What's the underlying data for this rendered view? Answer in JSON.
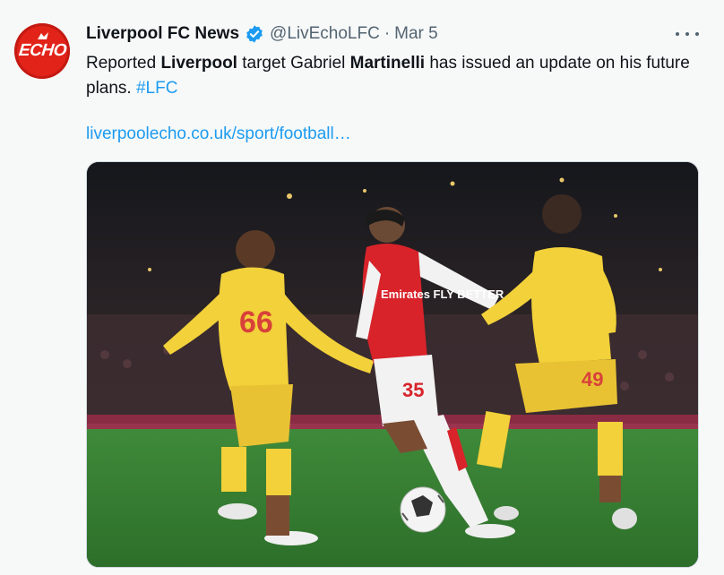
{
  "tweet": {
    "display_name": "Liverpool FC News",
    "handle": "@LivEchoLFC",
    "separator": "·",
    "date": "Mar 5",
    "text_parts": [
      "Reported ",
      "Liverpool",
      " target Gabriel ",
      "Martinelli",
      " has issued an update on his future plans. "
    ],
    "hashtag": "#LFC",
    "link": "liverpoolecho.co.uk/sport/football…",
    "avatar_logo_text": "ECHO",
    "icons": {
      "verified": "verified-badge-icon",
      "more": "more-options-icon"
    },
    "colors": {
      "link": "#1d9bf0",
      "avatar": "#e2231a",
      "verified": "#1d9bf0"
    },
    "media": {
      "description_icon": "football-photo",
      "jersey_left": "66",
      "jersey_center": "35",
      "jersey_right": "49",
      "shirt_sponsor": "Emirates FLY BETTER"
    }
  }
}
